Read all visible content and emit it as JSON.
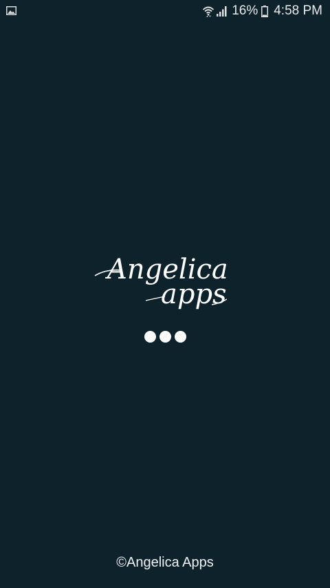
{
  "status_bar": {
    "icons": [
      "gallery-icon",
      "wifi-icon",
      "signal-icon",
      "battery-icon"
    ],
    "battery_percent": "16%",
    "battery_level": 0.16,
    "time": "4:58 PM"
  },
  "splash": {
    "logo_line1": "Angelica",
    "logo_line2": "apps",
    "loading_dot_count": 3
  },
  "footer": {
    "copyright": "©Angelica Apps"
  },
  "colors": {
    "background": "#0e222c",
    "foreground": "#ffffff"
  }
}
